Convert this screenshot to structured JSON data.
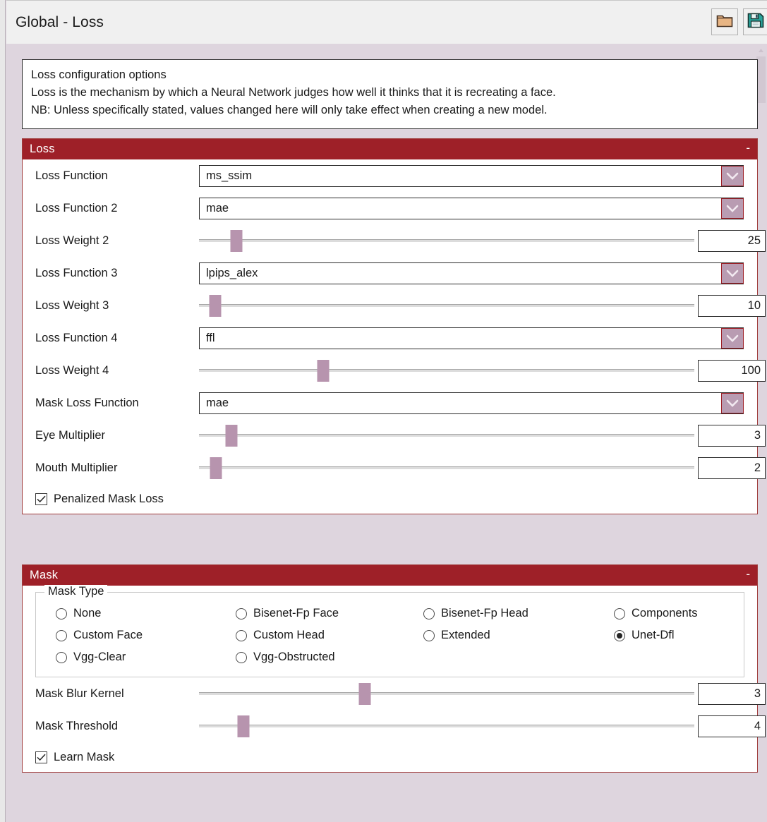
{
  "window": {
    "title": "Global - Loss",
    "toolbar": [
      {
        "name": "open-folder-button",
        "icon": "folder-icon",
        "label": "Open"
      },
      {
        "name": "save-button",
        "icon": "save-floppy-icon",
        "label": "Save"
      }
    ]
  },
  "info": {
    "heading": "Loss configuration options",
    "line2": "Loss is the mechanism by which a Neural Network judges how well it thinks that it is recreating a face.",
    "line3": "NB: Unless specifically stated, values changed here will only take effect when creating a new model."
  },
  "loss_section": {
    "title": "Loss",
    "collapse": "-",
    "rows": [
      {
        "label": "Loss Function",
        "type": "combo",
        "value": "ms_ssim"
      },
      {
        "label": "Loss Function 2",
        "type": "combo",
        "value": "mae"
      },
      {
        "label": "Loss Weight 2",
        "type": "slider",
        "value": "25",
        "pct": 7.6
      },
      {
        "label": "Loss Function 3",
        "type": "combo",
        "value": "lpips_alex"
      },
      {
        "label": "Loss Weight 3",
        "type": "slider",
        "value": "10",
        "pct": 3.3
      },
      {
        "label": "Loss Function 4",
        "type": "combo",
        "value": "ffl"
      },
      {
        "label": "Loss Weight 4",
        "type": "slider",
        "value": "100",
        "pct": 25.0
      },
      {
        "label": "Mask Loss Function",
        "type": "combo",
        "value": "mae"
      },
      {
        "label": "Eye Multiplier",
        "type": "slider",
        "value": "3",
        "pct": 6.5
      },
      {
        "label": "Mouth Multiplier",
        "type": "slider",
        "value": "2",
        "pct": 3.4
      }
    ],
    "checkbox": {
      "label": "Penalized Mask Loss",
      "checked": true
    }
  },
  "mask_section": {
    "title": "Mask",
    "collapse": "-",
    "mask_type": {
      "legend": "Mask Type",
      "options": [
        {
          "label": "None",
          "selected": false
        },
        {
          "label": "Bisenet-Fp Face",
          "selected": false
        },
        {
          "label": "Bisenet-Fp Head",
          "selected": false
        },
        {
          "label": "Components",
          "selected": false
        },
        {
          "label": "Custom Face",
          "selected": false
        },
        {
          "label": "Custom Head",
          "selected": false
        },
        {
          "label": "Extended",
          "selected": false
        },
        {
          "label": "Unet-Dfl",
          "selected": true
        },
        {
          "label": "Vgg-Clear",
          "selected": false
        },
        {
          "label": "Vgg-Obstructed",
          "selected": false
        }
      ]
    },
    "rows": [
      {
        "label": "Mask Blur Kernel",
        "type": "slider",
        "value": "3",
        "pct": 33.5
      },
      {
        "label": "Mask Threshold",
        "type": "slider",
        "value": "4",
        "pct": 9.0
      }
    ],
    "checkbox": {
      "label": "Learn Mask",
      "checked": true
    }
  },
  "colors": {
    "header_red": "#9e2028",
    "panel_border": "#a03c3c",
    "accent_mauve": "#b794ae",
    "window_bg": "#ded5de",
    "titlebar_bg": "#f0f0f0"
  }
}
